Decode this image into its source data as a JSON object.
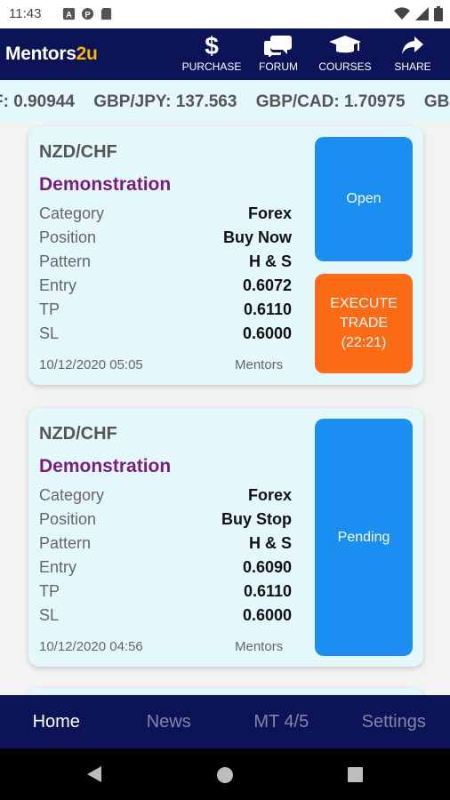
{
  "status_bar": {
    "time": "11:43",
    "icons": [
      "a-icon",
      "p-icon",
      "sd-card-icon"
    ],
    "right_icons": [
      "wifi-icon",
      "signal-icon",
      "battery-icon"
    ]
  },
  "app_bar": {
    "logo_main": "Mentors",
    "logo_accent": "2u",
    "nav": [
      {
        "label": "PURCHASE",
        "icon": "dollar-icon"
      },
      {
        "label": "FORUM",
        "icon": "chat-bubbles-icon"
      },
      {
        "label": "COURSES",
        "icon": "graduation-cap-icon"
      },
      {
        "label": "SHARE",
        "icon": "share-arrow-icon"
      }
    ]
  },
  "ticker": {
    "items": [
      "F: 0.90944",
      "GBP/JPY: 137.563",
      "GBP/CAD: 1.70975",
      "GBP"
    ]
  },
  "signals": [
    {
      "pair": "NZD/CHF",
      "type": "Demonstration",
      "fields": [
        {
          "key": "Category",
          "value": "Forex"
        },
        {
          "key": "Position",
          "value": "Buy Now"
        },
        {
          "key": "Pattern",
          "value": "H & S"
        },
        {
          "key": "Entry",
          "value": "0.6072"
        },
        {
          "key": "TP",
          "value": "0.6110"
        },
        {
          "key": "SL",
          "value": "0.6000"
        }
      ],
      "date": "10/12/2020 05:05",
      "by": "Mentors",
      "status_button": "Open",
      "execute_line1": "EXECUTE",
      "execute_line2": "TRADE",
      "execute_timer": "(22:21)"
    },
    {
      "pair": "NZD/CHF",
      "type": "Demonstration",
      "fields": [
        {
          "key": "Category",
          "value": "Forex"
        },
        {
          "key": "Position",
          "value": "Buy Stop"
        },
        {
          "key": "Pattern",
          "value": "H & S"
        },
        {
          "key": "Entry",
          "value": "0.6090"
        },
        {
          "key": "TP",
          "value": "0.6110"
        },
        {
          "key": "SL",
          "value": "0.6000"
        }
      ],
      "date": "10/12/2020 04:56",
      "by": "Mentors",
      "status_button": "Pending"
    }
  ],
  "tabs": [
    {
      "label": "Home",
      "active": true
    },
    {
      "label": "News",
      "active": false
    },
    {
      "label": "MT 4/5",
      "active": false
    },
    {
      "label": "Settings",
      "active": false
    }
  ],
  "system_nav": [
    "back-icon",
    "home-icon",
    "recents-icon"
  ],
  "colors": {
    "navy": "#0c1356",
    "card_bg": "#e4f8fb",
    "purple": "#7b1b7e",
    "blue_button": "#1b8ef2",
    "orange_button": "#fb6b16",
    "logo_accent": "#f5b800"
  }
}
